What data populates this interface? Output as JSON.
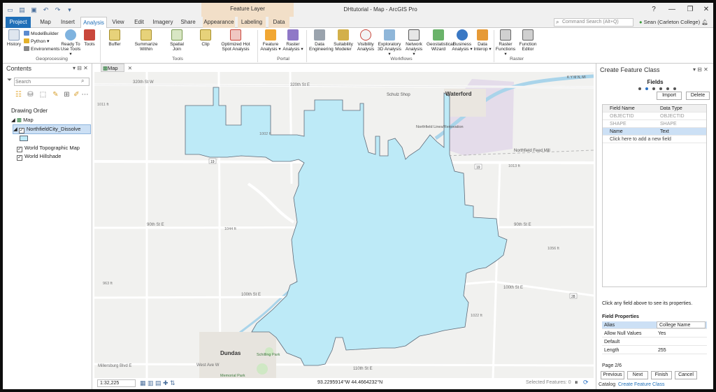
{
  "app": {
    "window_title": "DHtutorial - Map - ArcGIS Pro",
    "context_header": "Feature Layer",
    "help": "?",
    "minimize": "—",
    "restore": "❐",
    "close": "✕"
  },
  "tabs": [
    "Project",
    "Map",
    "Insert",
    "Analysis",
    "View",
    "Edit",
    "Imagery",
    "Share",
    "Appearance",
    "Labeling",
    "Data"
  ],
  "command_search": {
    "placeholder": "Command Search (Alt+Q)"
  },
  "user": {
    "name": "Sean (Carleton College)"
  },
  "ribbon": {
    "history": "History",
    "modelbuilder": "ModelBuilder",
    "python": "Python",
    "environments": "Environments",
    "ready_tools": "Ready To Use Tools",
    "tools": "Tools",
    "buffer": "Buffer",
    "summarize": "Summarize Within",
    "spatial_join": "Spatial Join",
    "clip": "Clip",
    "hotspot": "Optimized Hot Spot Analysis",
    "feature_analysis": "Feature Analysis",
    "raster_analysis": "Raster Analysis",
    "data_engineering": "Data Engineering",
    "suitability": "Suitability Modeler",
    "visibility": "Visibility Analysis",
    "exploratory": "Exploratory 3D Analysis",
    "network": "Network Analysis",
    "geostatistical": "Geostatistical Wizard",
    "business": "Business Analysis",
    "data_interop": "Data Interop",
    "raster_functions": "Raster Functions",
    "function_editor": "Function Editor",
    "groups": {
      "geoprocessing": "Geoprocessing",
      "tools": "Tools",
      "portal": "Portal",
      "workflows": "Workflows",
      "raster": "Raster"
    }
  },
  "contents": {
    "title": "Contents",
    "search_placeholder": "Search",
    "drawing_order": "Drawing Order",
    "layers": {
      "map": "Map",
      "dissolve": "NorthfieldCity_Dissolve",
      "topo": "World Topographic Map",
      "hillshade": "World Hillshade"
    }
  },
  "map_view": {
    "tab_label": "Map",
    "scale": "1:32,225",
    "coordinates": "93.2295914°W 44.4664232°N",
    "selected_features": "Selected Features: 0",
    "colors": {
      "polygon_fill": "#bdeaf7",
      "polygon_stroke": "#5e6a78",
      "background": "#f1f1ef"
    },
    "labels": {
      "road_320": "320th St W",
      "road_320e": "320th St E",
      "waterford": "Waterford",
      "schulz_shop": "Schulz Shop",
      "lines": "Northfield Lines/Renovation",
      "northfield_feed": "Northfield Feed Mill",
      "road_90w": "90th St E",
      "road_90e": "90th St E",
      "road_100w": "100th St E",
      "road_100e": "100th St E",
      "road_110": "110th St E",
      "dundas": "Dundas",
      "schilling": "Schilling Park",
      "memorial": "Memorial Park",
      "millersburg": "Millersburg Blvd E",
      "west_ave": "West Ave W",
      "elev_1011": "1011 ft",
      "elev_1013": "1013 ft",
      "elev_1044": "1044 ft",
      "elev_1056": "1056 ft",
      "elev_1022": "1022 ft",
      "elev_963": "963 ft",
      "elev_1002": "1002 ft",
      "hwy_19": "19",
      "hwy_19b": "19",
      "hwy_28": "28",
      "attribution": "K Y M N, MI"
    }
  },
  "pane": {
    "title": "Create Feature Class",
    "step_title": "Fields",
    "import": "Import",
    "delete": "Delete",
    "columns": [
      "Field Name",
      "Data Type"
    ],
    "rows": [
      {
        "name": "OBJECTID",
        "type": "OBJECTID"
      },
      {
        "name": "SHAPE",
        "type": "SHAPE"
      },
      {
        "name": "Name",
        "type": "Text"
      }
    ],
    "add_field": "Click here to add a new field",
    "hint": "Click any field above to see its properties.",
    "properties_title": "Field Properties",
    "properties": [
      {
        "key": "Alias",
        "value": "College Name"
      },
      {
        "key": "Allow Null Values",
        "value": "Yes"
      },
      {
        "key": "Default",
        "value": ""
      },
      {
        "key": "Length",
        "value": "255"
      }
    ],
    "page": "Page 2/6",
    "buttons": {
      "previous": "Previous",
      "next": "Next",
      "finish": "Finish",
      "cancel": "Cancel"
    },
    "bottom_tabs": {
      "catalog": "Catalog",
      "create": "Create Feature Class"
    }
  }
}
